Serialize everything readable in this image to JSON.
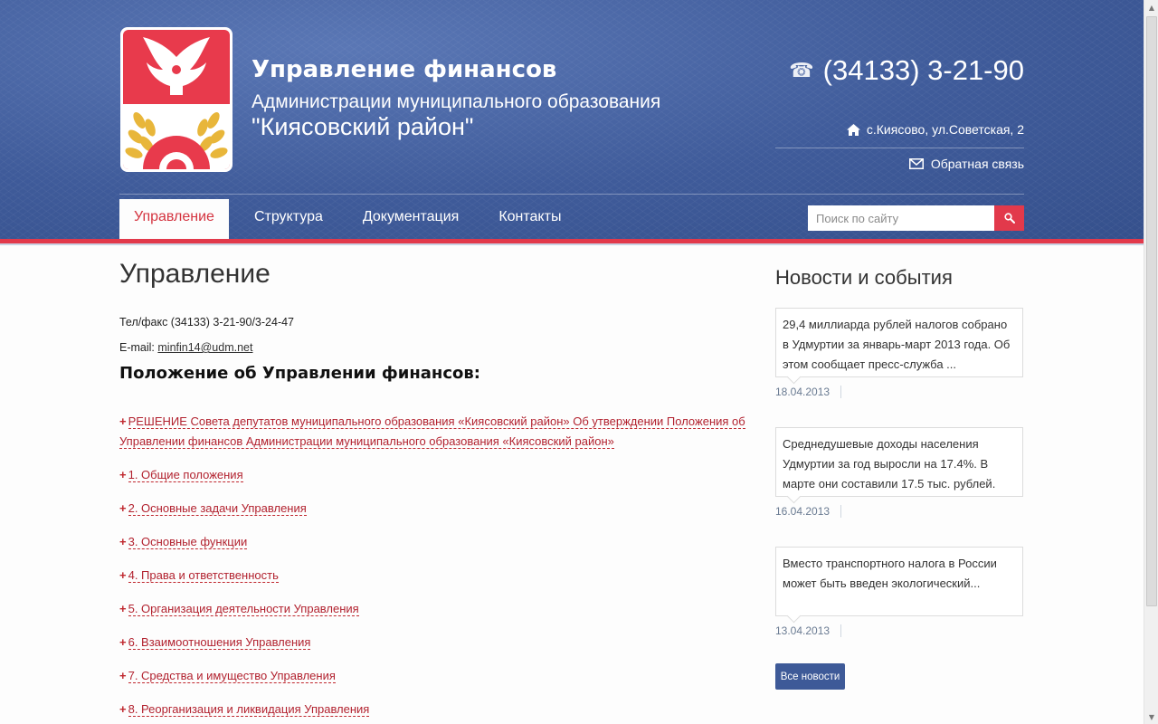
{
  "header": {
    "org_title": "Управление финансов",
    "org_subtitle_1": "Администрации муниципального образования",
    "org_subtitle_2": "\"Киясовский район\"",
    "phone": "(34133) 3-21-90",
    "address": "с.Киясово, ул.Советская, 2",
    "feedback": "Обратная связь",
    "colors": {
      "header_blue": "#3f5b9a",
      "accent_red": "#e2394b"
    }
  },
  "nav": {
    "items": [
      {
        "label": "Управление",
        "active": true
      },
      {
        "label": "Структура",
        "active": false
      },
      {
        "label": "Документация",
        "active": false
      },
      {
        "label": "Контакты",
        "active": false
      }
    ]
  },
  "search": {
    "placeholder": "Поиск по сайту"
  },
  "main": {
    "title": "Управление",
    "phone_line": "Тел/факс (34133) 3-21-90/3-24-47",
    "email_label": "E-mail: ",
    "email": "minfin14@udm.net",
    "section_heading": "Положение об Управлении финансов:",
    "documents": [
      "РЕШЕНИЕ Совета депутатов муниципального образования «Киясовский район» Об утверждении Положения об Управлении финансов Администрации муниципального образования «Киясовский район»",
      "1. Общие положения",
      "2. Основные задачи Управления",
      "3. Основные функции",
      "4. Права и ответственность",
      "5. Организация деятельности Управления",
      "6. Взаимоотношения Управления",
      "7. Средства и имущество Управления",
      "8. Реорганизация и ликвидация Управления"
    ]
  },
  "sidebar": {
    "heading": "Новости и события",
    "news": [
      {
        "text": "29,4 миллиарда рублей налогов собрано в Удмуртии за январь-март 2013 года. Об этом сообщает пресс-служба ...",
        "date": "18.04.2013"
      },
      {
        "text": "Среднедушевые доходы населения Удмуртии за год выросли на 17.4%. В марте они составили 17.5 тыс. рублей.",
        "date": "16.04.2013"
      },
      {
        "text": "Вместо транспортного налога в России может быть введен экологический...",
        "date": "13.04.2013"
      }
    ],
    "all_news_label": "Все новости"
  }
}
